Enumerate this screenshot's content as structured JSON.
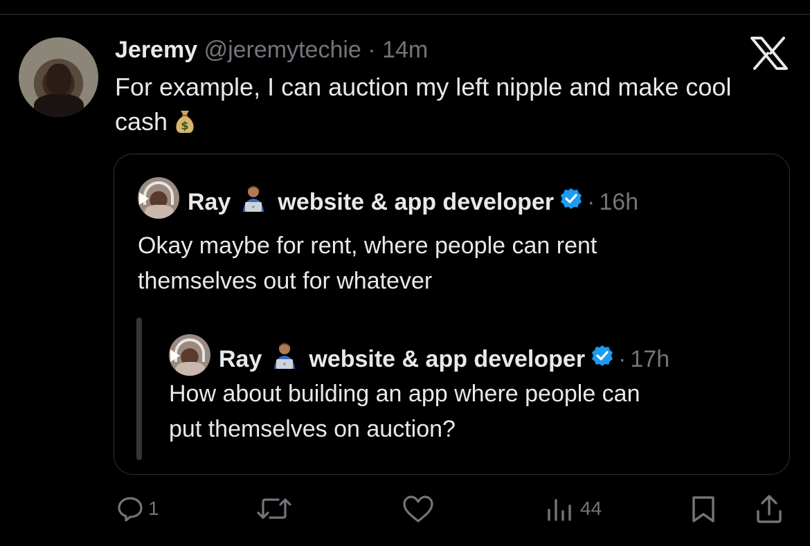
{
  "tweet": {
    "author_name": "Jeremy",
    "author_handle": "@jeremytechie",
    "separator": "·",
    "time": "14m",
    "text": "For example, I can auction my left nipple and make cool cash",
    "emoji": "money-bag"
  },
  "quote": {
    "author_name": "Ray",
    "author_title": "website & app developer",
    "separator": "·",
    "time": "16h",
    "text_line1": "Okay maybe for rent, where people can rent",
    "text_line2": "themselves out for whatever"
  },
  "nested_quote": {
    "author_name": "Ray",
    "author_title": "website & app developer",
    "separator": "·",
    "time": "17h",
    "text_line1": "How about building an app where people can",
    "text_line2": "put themselves on auction?"
  },
  "actions": {
    "reply_count": "1",
    "repost_count": "",
    "like_count": "",
    "views_count": "44"
  },
  "colors": {
    "background": "#000000",
    "text": "#e7e9ea",
    "muted": "#71767b",
    "border": "#2f3336",
    "verified": "#1d9bf0"
  }
}
